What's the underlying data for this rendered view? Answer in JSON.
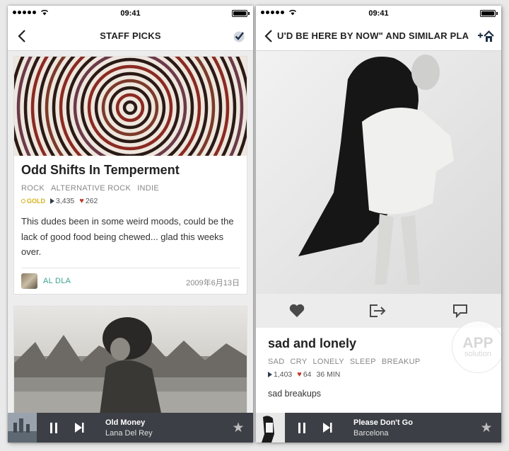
{
  "status_bar": {
    "time": "09:41"
  },
  "left": {
    "nav": {
      "title": "STAFF PICKS",
      "back_icon": "chevron-left-icon",
      "right_icon": "check-circle-icon"
    },
    "card": {
      "title": "Odd Shifts In Temperment",
      "tags": [
        "ROCK",
        "ALTERNATIVE ROCK",
        "INDIE"
      ],
      "badge": "GOLD",
      "plays": "3,435",
      "likes": "262",
      "description": "This dudes been in some weird moods, could be the lack of good food being chewed... glad this weeks over.",
      "author": "AL DLA",
      "date": "2009年6月13日"
    },
    "player": {
      "song": "Old Money",
      "artist": "Lana Del Rey"
    }
  },
  "right": {
    "nav": {
      "title": "U'D BE HERE BY NOW\" AND SIMILAR PLA",
      "back_icon": "chevron-left-icon",
      "right_icon": "plus-home-icon"
    },
    "actions": [
      "heart-icon",
      "share-icon",
      "comment-icon"
    ],
    "track": {
      "title": "sad and lonely",
      "tags": [
        "SAD",
        "CRY",
        "LONELY",
        "SLEEP",
        "BREAKUP"
      ],
      "plays": "1,403",
      "likes": "64",
      "duration": "36 MIN",
      "description": "sad breakups"
    },
    "watermark": {
      "line1": "APP",
      "line2": "solution"
    },
    "player": {
      "song": "Please Don't Go",
      "artist": "Barcelona"
    }
  },
  "colors": {
    "accent_teal": "#3aa38f",
    "gold": "#d6b21c",
    "heart": "#c0392b",
    "player_bg": "#3c3f45",
    "nav_text": "#222222"
  }
}
